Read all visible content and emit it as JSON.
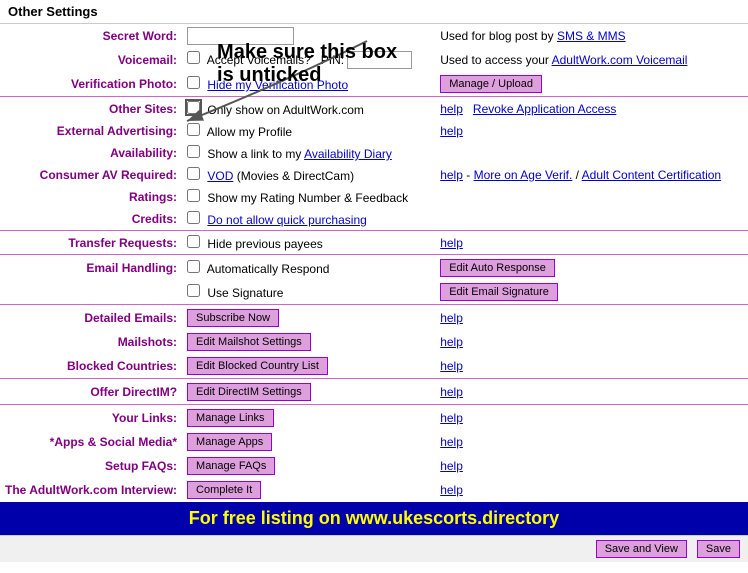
{
  "header": {
    "title": "Other Settings"
  },
  "footer": {
    "text": "For free listing on www.ukescorts.directory"
  },
  "rows": [
    {
      "label": "Secret Word:",
      "input_type": "text",
      "input_size": 12,
      "info": "Used for blog post by ",
      "info_link": "SMS & MMS"
    },
    {
      "label": "Voicemail:",
      "has_checkbox": true,
      "checkbox_label": "Accept Voicemails?",
      "has_pin": true,
      "pin_label": "PIN:",
      "info": "Used to access your ",
      "info_link": "AdultWork.com Voicemail"
    },
    {
      "label": "Verification Photo:",
      "has_checkbox": true,
      "checkbox_link": "Hide my Verification Photo",
      "button_label": "Manage / Upload"
    },
    {
      "label": "Other Sites:",
      "has_checkbox": true,
      "checkbox_circled": true,
      "checkbox_label": "Only show on AdultWork.com",
      "has_help": true,
      "help_label": "help",
      "info_link": "Revoke Application Access"
    },
    {
      "label": "External Advertising:",
      "has_checkbox": true,
      "checkbox_label": "Allow my Profile",
      "has_help": true,
      "help_label": "help"
    },
    {
      "label": "Availability:",
      "has_checkbox": true,
      "checkbox_label_prefix": "Show a link to my ",
      "checkbox_link": "Availability Diary"
    },
    {
      "label": "Consumer AV Required:",
      "has_checkbox": true,
      "vod_link": "VOD",
      "vod_suffix": " (Movies & DirectCam)",
      "has_help": true,
      "help_label": "help",
      "info_dash": " - ",
      "more_link": "More on Age Verif.",
      "slash": " / ",
      "cert_link": "Adult Content Certification",
      "annotation": true
    },
    {
      "label": "Ratings:",
      "has_checkbox": true,
      "checkbox_label": "Show my Rating Number & Feedback"
    },
    {
      "label": "Credits:",
      "has_checkbox": true,
      "checkbox_link": "Do not allow quick purchasing"
    },
    {
      "label": "Transfer Requests:",
      "has_checkbox": true,
      "checkbox_label": "Hide previous payees",
      "has_help": true,
      "help_label": "help"
    },
    {
      "label": "Email Handling:",
      "has_checkbox": true,
      "checkbox_label": "Automatically Respond",
      "button_label": "Edit Auto Response"
    },
    {
      "label": "",
      "has_checkbox": true,
      "checkbox_label": "Use Signature",
      "button_label": "Edit Email Signature"
    },
    {
      "label": "Detailed Emails:",
      "button_label": "Subscribe Now",
      "has_help": true,
      "help_label": "help"
    },
    {
      "label": "Mailshots:",
      "button_label": "Edit Mailshot Settings",
      "has_help": true,
      "help_label": "help"
    },
    {
      "label": "Blocked Countries:",
      "button_label": "Edit Blocked Country List",
      "has_help": true,
      "help_label": "help"
    },
    {
      "label": "Offer DirectIM?",
      "button_label": "Edit DirectIM Settings",
      "has_help": true,
      "help_label": "help"
    },
    {
      "label": "Your Links:",
      "button_label": "Manage Links",
      "has_help": true,
      "help_label": "help"
    },
    {
      "label": "*Apps & Social Media*",
      "button_label": "Manage Apps",
      "has_help": true,
      "help_label": "help"
    },
    {
      "label": "Setup FAQs:",
      "button_label": "Manage FAQs",
      "has_help": true,
      "help_label": "help"
    },
    {
      "label": "The AdultWork.com Interview:",
      "button_label": "Complete It",
      "has_help": true,
      "help_label": "help"
    }
  ],
  "buttons": {
    "save_and_view": "Save and View",
    "save": "Save"
  }
}
